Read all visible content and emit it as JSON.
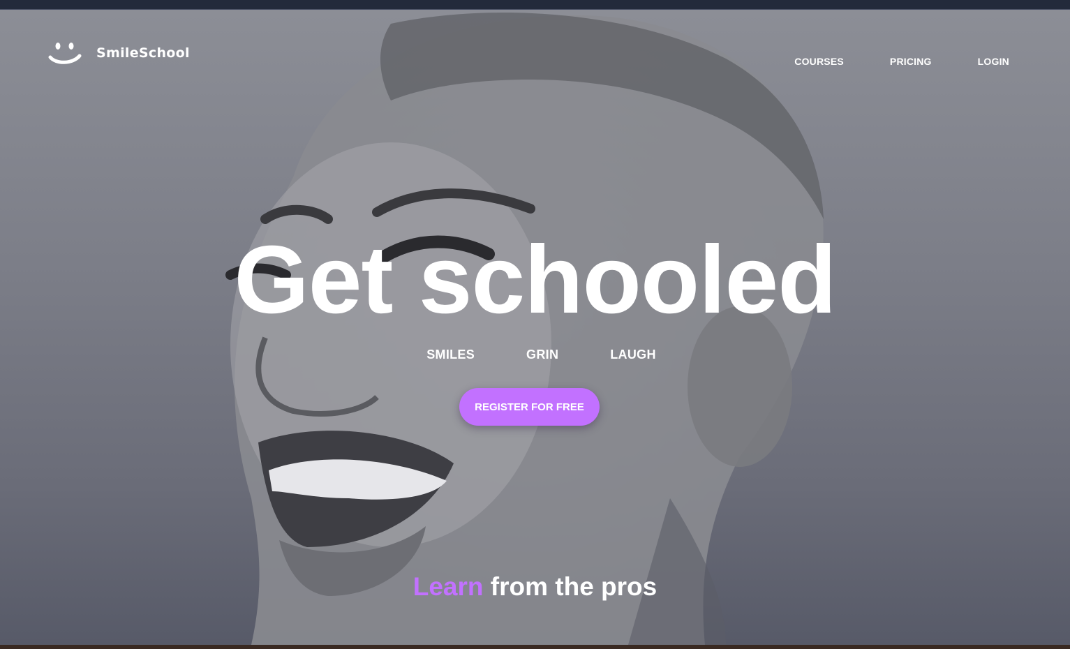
{
  "brand": {
    "name": "SmileSchool",
    "logo_icon": "smiley-face-icon",
    "accent_color": "#c271ff"
  },
  "nav": {
    "items": [
      {
        "label": "COURSES"
      },
      {
        "label": "PRICING"
      },
      {
        "label": "LOGIN"
      }
    ]
  },
  "hero": {
    "headline": "Get schooled",
    "sub_words": [
      "SMILES",
      "GRIN",
      "LAUGH"
    ],
    "cta_label": "REGISTER FOR FREE",
    "background": "grayscale-portrait-laughing-woman"
  },
  "tagline": {
    "accent": "Learn",
    "rest": "from the pros"
  }
}
